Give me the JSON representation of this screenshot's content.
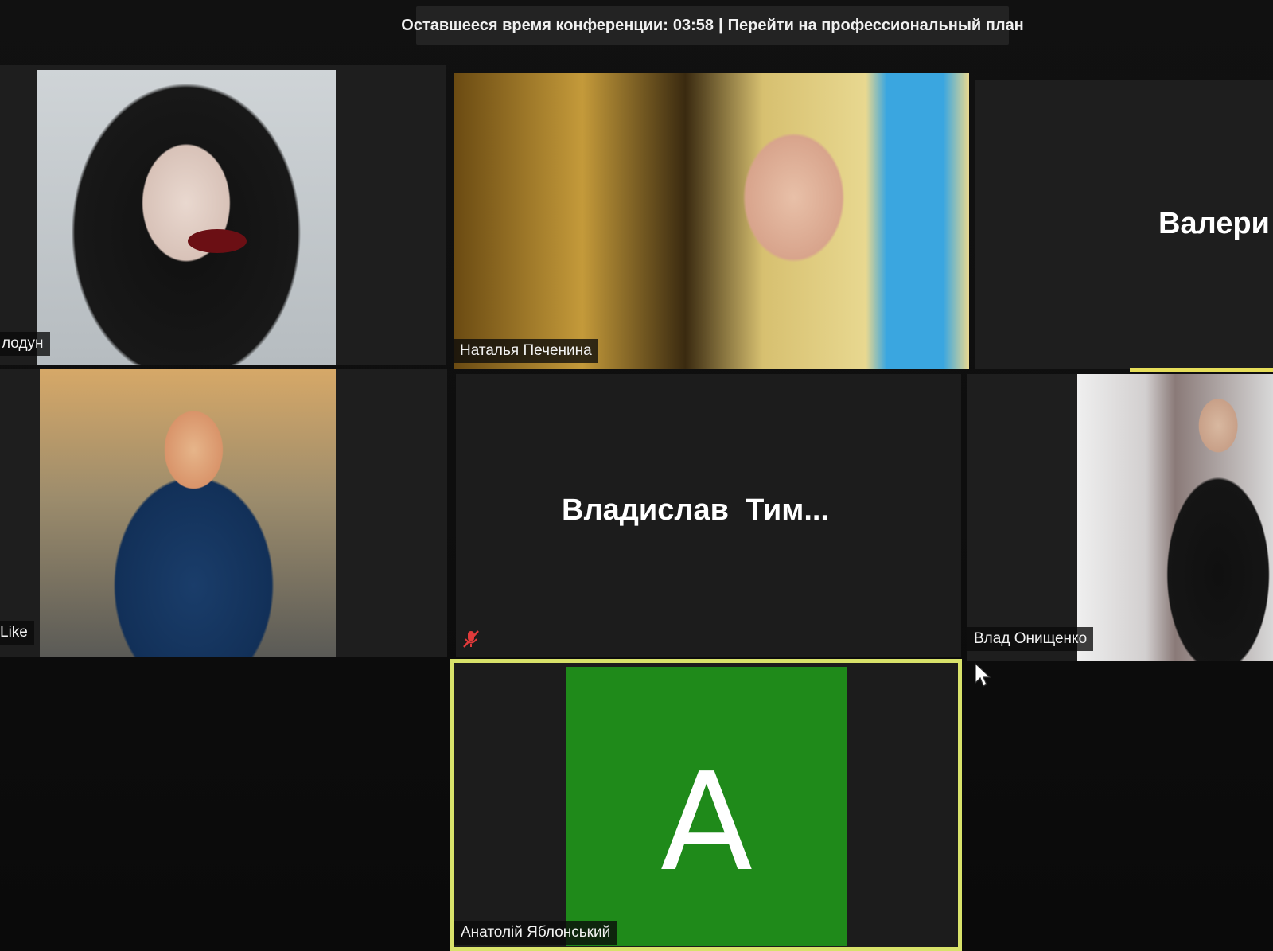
{
  "banner": {
    "remaining_label": "Оставшееся время конференции:",
    "time": "03:58",
    "separator": "|",
    "upgrade_link": "Перейти на профессиональный план"
  },
  "participants": [
    {
      "name": "лодун",
      "display": "video"
    },
    {
      "name": "Наталья Печенина",
      "display": "video"
    },
    {
      "name": "Валери",
      "display": "name-only"
    },
    {
      "name": "Like",
      "display": "video"
    },
    {
      "name": "Владислав  Тим...",
      "display": "name-only",
      "muted": true
    },
    {
      "name": "Влад Онищенко",
      "display": "video"
    },
    {
      "name": "Анатолій Яблонський",
      "display": "avatar",
      "avatar_letter": "A",
      "avatar_color": "#1f8a1a",
      "active_speaker": true
    }
  ],
  "colors": {
    "active_speaker_border": "#d8e26a",
    "muted_icon": "#e03a3a"
  },
  "icons": {
    "muted": "muted-mic-icon",
    "cursor": "mouse-pointer-icon"
  }
}
